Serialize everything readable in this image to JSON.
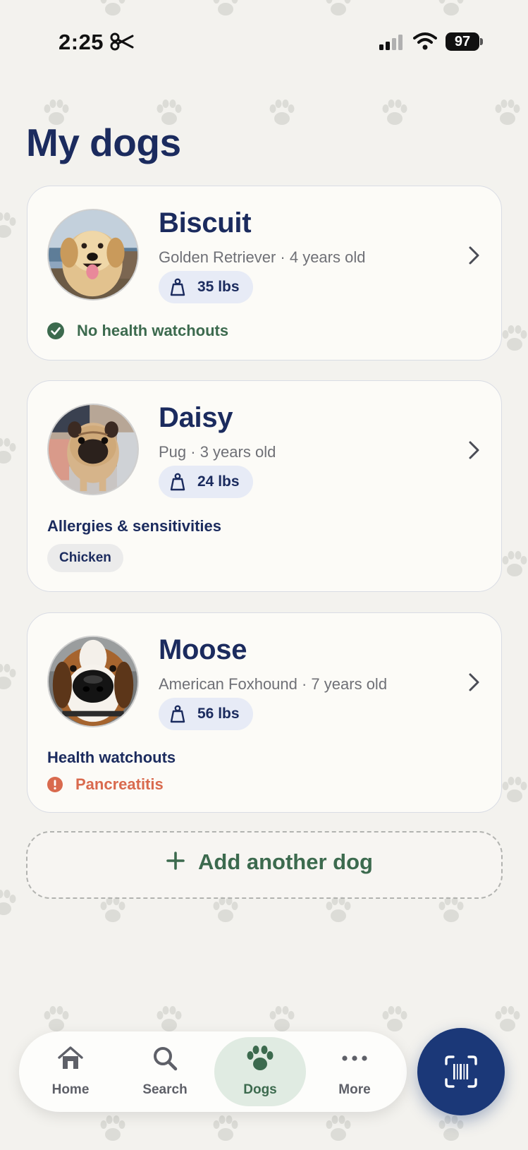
{
  "status_bar": {
    "time": "2:25",
    "battery": "97"
  },
  "page": {
    "title": "My dogs"
  },
  "dogs": [
    {
      "name": "Biscuit",
      "breed_age": "Golden Retriever · 4 years old",
      "weight": "35 lbs",
      "status": "No health watchouts"
    },
    {
      "name": "Daisy",
      "breed_age": "Pug · 3 years old",
      "weight": "24 lbs",
      "section_label": "Allergies & sensitivities",
      "tags": [
        "Chicken"
      ]
    },
    {
      "name": "Moose",
      "breed_age": "American Foxhound · 7 years old",
      "weight": "56 lbs",
      "section_label": "Health watchouts",
      "watchouts": [
        "Pancreatitis"
      ]
    }
  ],
  "add_dog": {
    "label": "Add another dog"
  },
  "tabbar": {
    "tabs": [
      {
        "label": "Home",
        "icon": "home-icon"
      },
      {
        "label": "Search",
        "icon": "search-icon"
      },
      {
        "label": "Dogs",
        "icon": "paw-icon",
        "active": true
      },
      {
        "label": "More",
        "icon": "more-icon"
      }
    ],
    "scan_icon": "barcode-scan-icon"
  },
  "colors": {
    "navy": "#1b2b5e",
    "green": "#3c6a4e",
    "warning": "#d96a4e",
    "background": "#f3f2ee",
    "scan_button": "#1b3878"
  }
}
